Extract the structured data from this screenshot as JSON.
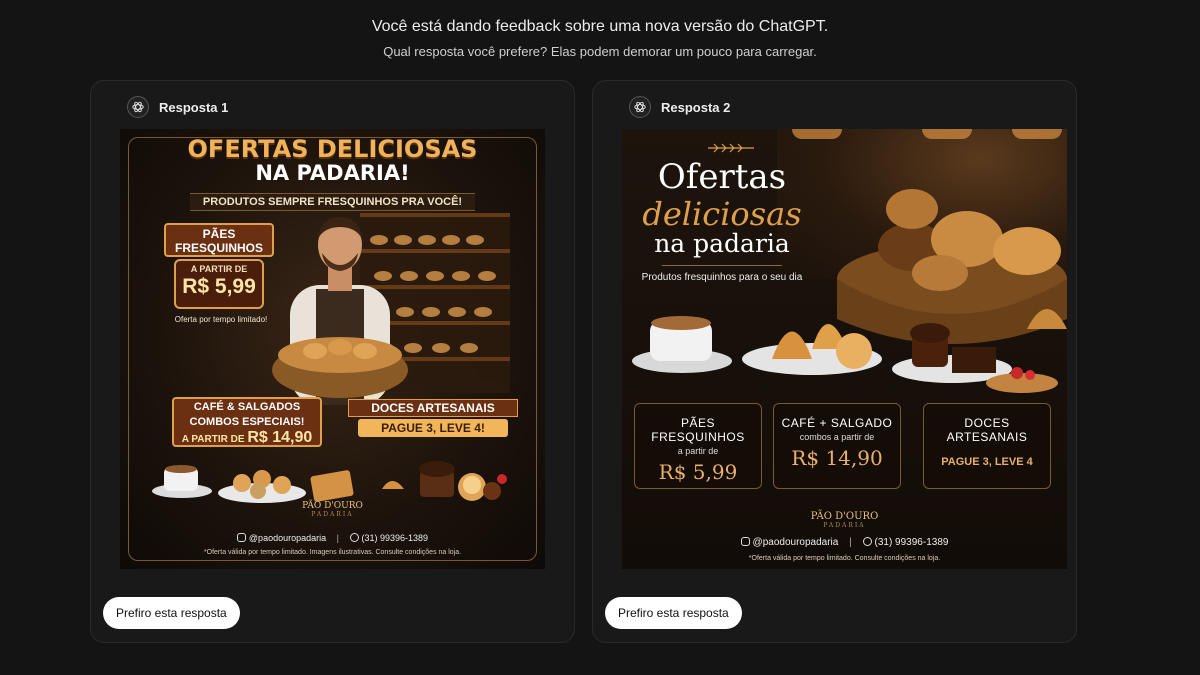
{
  "header": {
    "title": "Você está dando feedback sobre uma nova versão do ChatGPT.",
    "subtitle": "Qual resposta você prefere? Elas podem demorar um pouco para carregar."
  },
  "responses": [
    {
      "label": "Resposta 1",
      "button": "Prefiro esta resposta",
      "poster": {
        "headline_1": "OFERTAS DELICIOSAS",
        "headline_2": "NA PADARIA!",
        "tagline": "PRODUTOS SEMPRE FRESQUINHOS PRA VOCÊ!",
        "badge_title": "PÃES FRESQUINHOS",
        "badge_from": "A PARTIR DE",
        "badge_price": "R$ 5,99",
        "badge_note": "Oferta por tempo limitado!",
        "combo_line1": "CAFÉ & SALGADOS",
        "combo_line2": "COMBOS ESPECIAIS!",
        "combo_from": "A PARTIR DE",
        "combo_price": "R$ 14,90",
        "doces_title": "DOCES ARTESANAIS",
        "doces_offer": "PAGUE 3, LEVE 4!",
        "brand": "PÃO D'OURO",
        "brand_sub": "PADARIA",
        "handle": "@paodouropadaria",
        "phone": "(31) 99396-1389",
        "disclaimer": "*Oferta válida por tempo limitado. Imagens ilustrativas. Consulte condições na loja."
      }
    },
    {
      "label": "Resposta 2",
      "button": "Prefiro esta resposta",
      "poster": {
        "title_1": "Ofertas",
        "title_2": "deliciosas",
        "title_3": "na padaria",
        "subtitle": "Produtos fresquinhos para o seu dia",
        "boxes": [
          {
            "name": "PÃES FRESQUINHOS",
            "sub": "a partir de",
            "price": "R$ 5,99"
          },
          {
            "name": "CAFÉ + SALGADO",
            "sub": "combos a partir de",
            "price": "R$ 14,90"
          },
          {
            "name": "DOCES ARTESANAIS",
            "offer": "PAGUE 3, LEVE 4"
          }
        ],
        "brand": "PÃO D'OURO",
        "brand_sub": "PADARIA",
        "handle": "@paodouropadaria",
        "phone": "(31) 99396-1389",
        "disclaimer": "*Oferta válida por tempo limitado. Consulte condições na loja."
      }
    }
  ],
  "colors": {
    "background": "#141414",
    "card": "#191919",
    "gold": "#e0a04a"
  }
}
